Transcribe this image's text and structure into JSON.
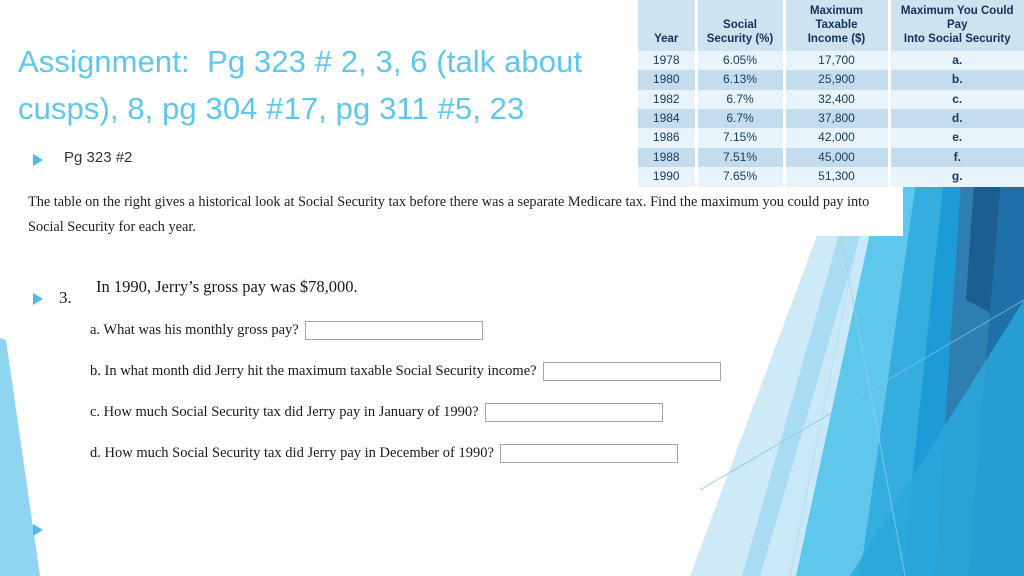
{
  "slide": {
    "title": "Assignment:  Pg 323 # 2, 3, 6 (talk about cusps), 8, pg 304 #17, pg 311 #5, 23",
    "title_color": "#5FC6EC",
    "background_color": "#FFFFFF"
  },
  "bullets": {
    "first": "Pg 323 #2",
    "third_number": "3.",
    "last": ""
  },
  "body": {
    "paragraph": "The table on the right gives a historical look at Social Security tax before there was a separate Medicare tax. Find the maximum you could pay into Social Security for each year."
  },
  "question3": {
    "stem": "In 1990, Jerry’s gross pay was $78,000.",
    "parts": [
      {
        "id": "a",
        "label": "a. What was his monthly gross pay?",
        "answer": ""
      },
      {
        "id": "b",
        "label": "b. In what month did Jerry hit the maximum taxable Social Security income?",
        "answer": ""
      },
      {
        "id": "c",
        "label": "c. How much Social Security tax did Jerry pay in January of 1990?",
        "answer": ""
      },
      {
        "id": "d",
        "label": "d. How much Social Security tax did Jerry pay in December of 1990?",
        "answer": ""
      }
    ]
  },
  "table": {
    "headers": [
      "Year",
      "Social Security (%)",
      "Maximum Taxable Income ($)",
      "Maximum You Could Pay Into Social Security"
    ],
    "headers_lines": [
      [
        "",
        "Year"
      ],
      [
        "Social",
        "Security (%)"
      ],
      [
        "Maximum Taxable",
        "Income ($)"
      ],
      [
        "Maximum You Could Pay",
        "Into Social Security"
      ]
    ],
    "rows": [
      {
        "year": "1978",
        "rate": "6.05%",
        "income": "17,700",
        "pay": "a."
      },
      {
        "year": "1980",
        "rate": "6.13%",
        "income": "25,900",
        "pay": "b."
      },
      {
        "year": "1982",
        "rate": "6.7%",
        "income": "32,400",
        "pay": "c."
      },
      {
        "year": "1984",
        "rate": "6.7%",
        "income": "37,800",
        "pay": "d."
      },
      {
        "year": "1986",
        "rate": "7.15%",
        "income": "42,000",
        "pay": "e."
      },
      {
        "year": "1988",
        "rate": "7.51%",
        "income": "45,000",
        "pay": "f."
      },
      {
        "year": "1990",
        "rate": "7.65%",
        "income": "51,300",
        "pay": "g."
      }
    ],
    "header_bg": "#CFE2EF",
    "row_bg_odd": "#E9F3FA",
    "row_bg_even": "#C3DDEE",
    "text_color": "#1A3C61"
  },
  "decoration": {
    "palette": {
      "pale_blue": "#CFEAF7",
      "light_blue": "#A9DCF2",
      "sky_blue": "#5FC6EC",
      "mid_blue": "#35ADDE",
      "azure": "#1C9BD4",
      "steel_blue": "#2E7FB0",
      "navy_blue": "#1F6FA8",
      "deep_navy": "#1C5E8E",
      "hairline": "#8FC8E4"
    }
  }
}
